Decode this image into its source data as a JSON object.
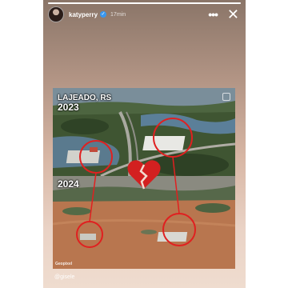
{
  "story": {
    "username": "katyperry",
    "time": "17min",
    "progress": 1.0,
    "mention": "@gisele"
  },
  "post": {
    "city_label": "LAJEADO, RS",
    "year_before": "2023",
    "year_after": "2024",
    "watermark": "Geopixel"
  },
  "icons": {
    "verified": "verified-badge-icon",
    "more": "more-options-icon",
    "close": "close-icon",
    "heart": "broken-heart-icon"
  },
  "colors": {
    "annotation_red": "#e02020",
    "flood_water": "#b8764f",
    "verified_blue": "#3897f0"
  }
}
